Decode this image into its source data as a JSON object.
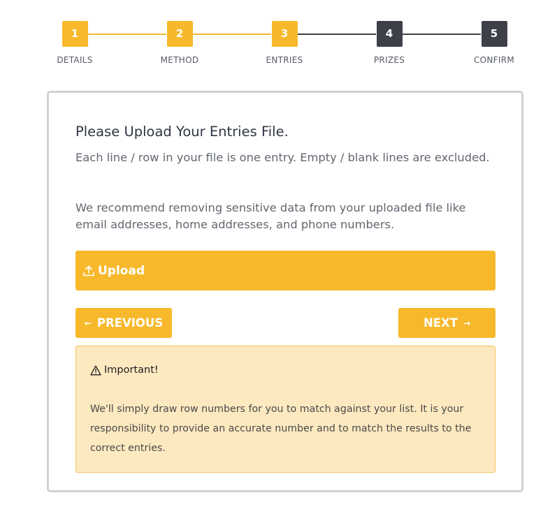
{
  "stepper": {
    "steps": [
      {
        "number": "1",
        "label": "DETAILS",
        "state": "completed"
      },
      {
        "number": "2",
        "label": "METHOD",
        "state": "completed"
      },
      {
        "number": "3",
        "label": "ENTRIES",
        "state": "current"
      },
      {
        "number": "4",
        "label": "PRIZES",
        "state": "pending"
      },
      {
        "number": "5",
        "label": "CONFIRM",
        "state": "pending"
      }
    ]
  },
  "main": {
    "title": "Please Upload Your Entries File.",
    "paragraph_1": "Each line / row in your file is one entry. Empty / blank lines are excluded.",
    "paragraph_2": "We recommend removing sensitive data from your uploaded file like email addresses, home addresses, and phone numbers.",
    "upload_label": "Upload",
    "upload_icon": "upload-icon",
    "previous_label": "PREVIOUS",
    "next_label": "NEXT"
  },
  "alert": {
    "icon": "warning-icon",
    "title": "Important!",
    "body": "We'll simply draw row numbers for you to match against your list. It is your responsibility to provide an accurate number and to match the results to the correct entries."
  },
  "colors": {
    "accent": "#f7b92b",
    "pending_step": "#3d4049",
    "alert_background": "#fde9c0",
    "card_border": "#d2d2d4"
  }
}
